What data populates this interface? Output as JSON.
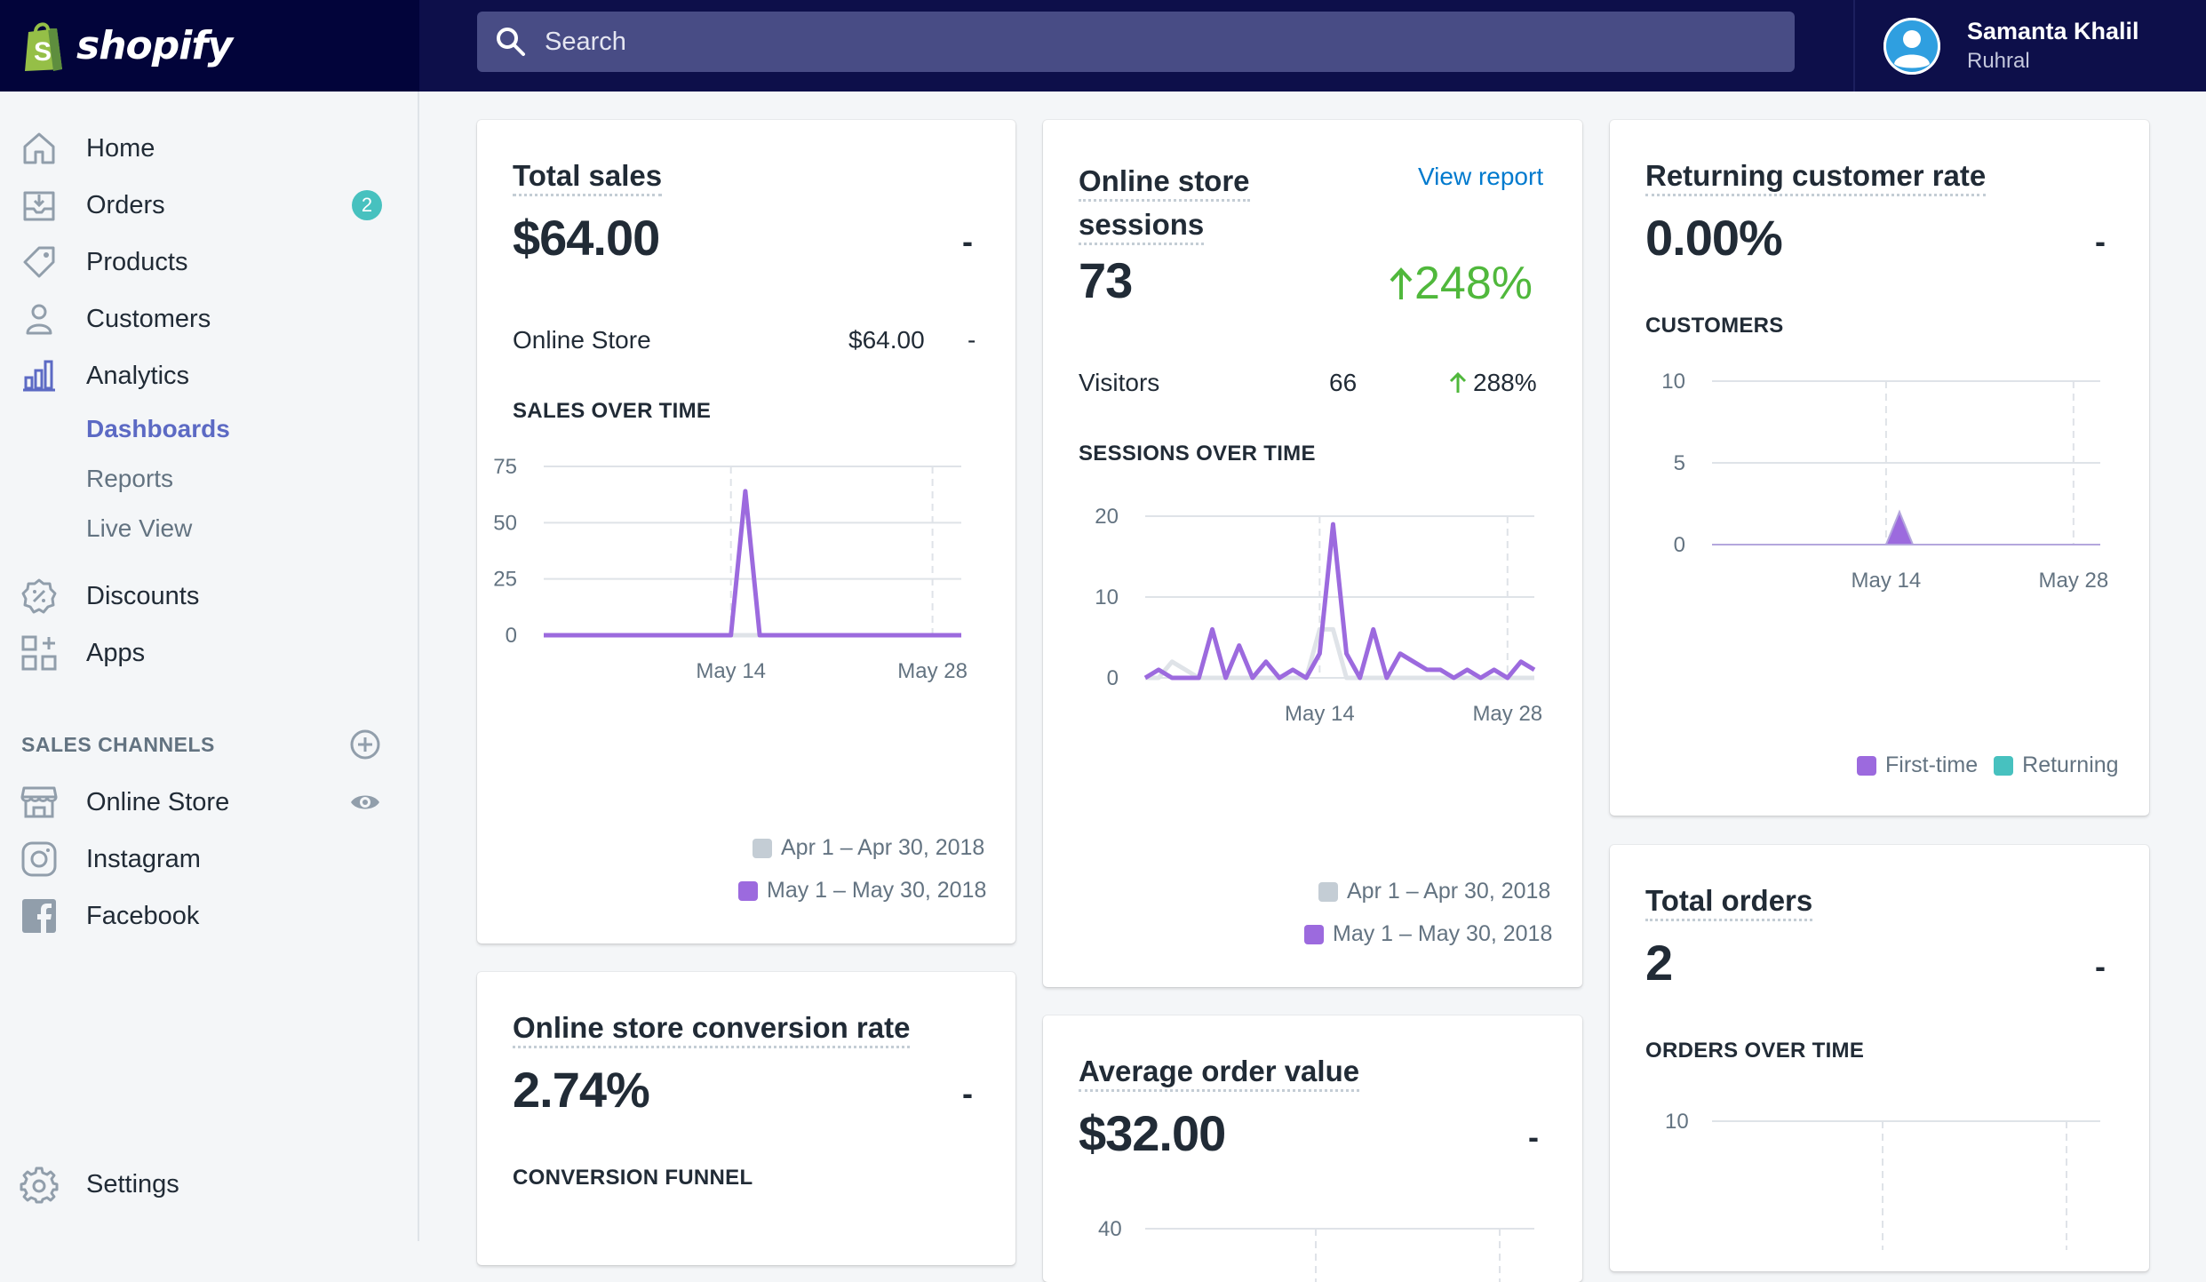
{
  "app": {
    "logo_text": "shopify"
  },
  "search": {
    "placeholder": "Search"
  },
  "user": {
    "name": "Samanta Khalil",
    "shop": "Ruhral"
  },
  "sidebar": {
    "items": [
      {
        "label": "Home",
        "icon": "home-icon"
      },
      {
        "label": "Orders",
        "icon": "orders-icon",
        "badge": "2"
      },
      {
        "label": "Products",
        "icon": "tag-icon"
      },
      {
        "label": "Customers",
        "icon": "customer-icon"
      },
      {
        "label": "Analytics",
        "icon": "analytics-icon"
      }
    ],
    "analytics_sub": [
      {
        "label": "Dashboards",
        "active": true
      },
      {
        "label": "Reports"
      },
      {
        "label": "Live View"
      }
    ],
    "items2": [
      {
        "label": "Discounts",
        "icon": "discount-icon"
      },
      {
        "label": "Apps",
        "icon": "apps-icon"
      }
    ],
    "sales_channels_title": "SALES CHANNELS",
    "channels": [
      {
        "label": "Online Store",
        "icon": "store-icon"
      },
      {
        "label": "Instagram",
        "icon": "instagram-icon"
      },
      {
        "label": "Facebook",
        "icon": "facebook-icon"
      }
    ],
    "settings_label": "Settings"
  },
  "cards": {
    "total_sales": {
      "title": "Total sales",
      "value": "$64.00",
      "change": "-",
      "row_label": "Online Store",
      "row_value": "$64.00",
      "row_change": "-",
      "section": "SALES OVER TIME",
      "legend": [
        "Apr 1 – Apr 30, 2018",
        "May 1 – May 30, 2018"
      ]
    },
    "sessions": {
      "title_line1": "Online store",
      "title_line2": "sessions",
      "link": "View report",
      "value": "73",
      "growth": "248%",
      "row_label": "Visitors",
      "row_value": "66",
      "row_growth": "288%",
      "section": "SESSIONS OVER TIME",
      "legend": [
        "Apr 1 – Apr 30, 2018",
        "May 1 – May 30, 2018"
      ]
    },
    "returning": {
      "title": "Returning customer rate",
      "value": "0.00%",
      "change": "-",
      "section": "CUSTOMERS",
      "legend": [
        "First-time",
        "Returning"
      ]
    },
    "conversion": {
      "title": "Online store conversion rate",
      "value": "2.74%",
      "change": "-",
      "section": "CONVERSION FUNNEL"
    },
    "aov": {
      "title": "Average order value",
      "value": "$32.00",
      "change": "-",
      "axis_top": "40"
    },
    "total_orders": {
      "title": "Total orders",
      "value": "2",
      "change": "-",
      "section": "ORDERS OVER TIME",
      "axis_top": "10"
    }
  },
  "colors": {
    "current": "#9c6ade",
    "previous": "#dfe3e8",
    "returning": "#47c1bf",
    "accent": "#5c6ac4"
  },
  "chart_data": [
    {
      "type": "line",
      "name": "SALES OVER TIME",
      "x_ticks": [
        "May 14",
        "May 28"
      ],
      "y_ticks": [
        0,
        25,
        50,
        75
      ],
      "ylim": [
        0,
        75
      ],
      "series": [
        {
          "name": "May 1 – May 30, 2018",
          "values": [
            0,
            0,
            0,
            0,
            0,
            0,
            0,
            0,
            0,
            0,
            0,
            0,
            0,
            0,
            64,
            0,
            0,
            0,
            0,
            0,
            0,
            0,
            0,
            0,
            0,
            0,
            0,
            0,
            0,
            0
          ]
        },
        {
          "name": "Apr 1 – Apr 30, 2018",
          "values": [
            0,
            0,
            0,
            0,
            0,
            0,
            0,
            0,
            0,
            0,
            0,
            0,
            0,
            0,
            0,
            0,
            0,
            0,
            0,
            0,
            0,
            0,
            0,
            0,
            0,
            0,
            0,
            0,
            0,
            0
          ]
        }
      ]
    },
    {
      "type": "line",
      "name": "SESSIONS OVER TIME",
      "x_ticks": [
        "May 14",
        "May 28"
      ],
      "y_ticks": [
        0,
        10,
        20
      ],
      "ylim": [
        0,
        20
      ],
      "series": [
        {
          "name": "May 1 – May 30, 2018",
          "values": [
            0,
            1,
            0,
            0,
            0,
            6,
            0,
            4,
            0,
            2,
            0,
            1,
            0,
            3,
            19,
            3,
            0,
            6,
            0,
            3,
            2,
            1,
            1,
            0,
            1,
            0,
            1,
            0,
            2,
            1
          ]
        },
        {
          "name": "Apr 1 – Apr 30, 2018",
          "values": [
            0,
            0,
            2,
            1,
            0,
            0,
            0,
            0,
            0,
            0,
            0,
            0,
            0,
            6,
            6,
            0,
            0,
            0,
            0,
            0,
            0,
            0,
            0,
            0,
            0,
            0,
            0,
            0,
            0,
            0
          ]
        }
      ]
    },
    {
      "type": "area",
      "name": "CUSTOMERS",
      "x_ticks": [
        "May 14",
        "May 28"
      ],
      "y_ticks": [
        0,
        5,
        10
      ],
      "ylim": [
        0,
        10
      ],
      "series": [
        {
          "name": "First-time",
          "values": [
            0,
            0,
            0,
            0,
            0,
            0,
            0,
            0,
            0,
            0,
            0,
            0,
            0,
            0,
            2,
            0,
            0,
            0,
            0,
            0,
            0,
            0,
            0,
            0,
            0,
            0,
            0,
            0,
            0,
            0
          ]
        },
        {
          "name": "Returning",
          "values": [
            0,
            0,
            0,
            0,
            0,
            0,
            0,
            0,
            0,
            0,
            0,
            0,
            0,
            0,
            0,
            0,
            0,
            0,
            0,
            0,
            0,
            0,
            0,
            0,
            0,
            0,
            0,
            0,
            0,
            0
          ]
        }
      ]
    }
  ]
}
